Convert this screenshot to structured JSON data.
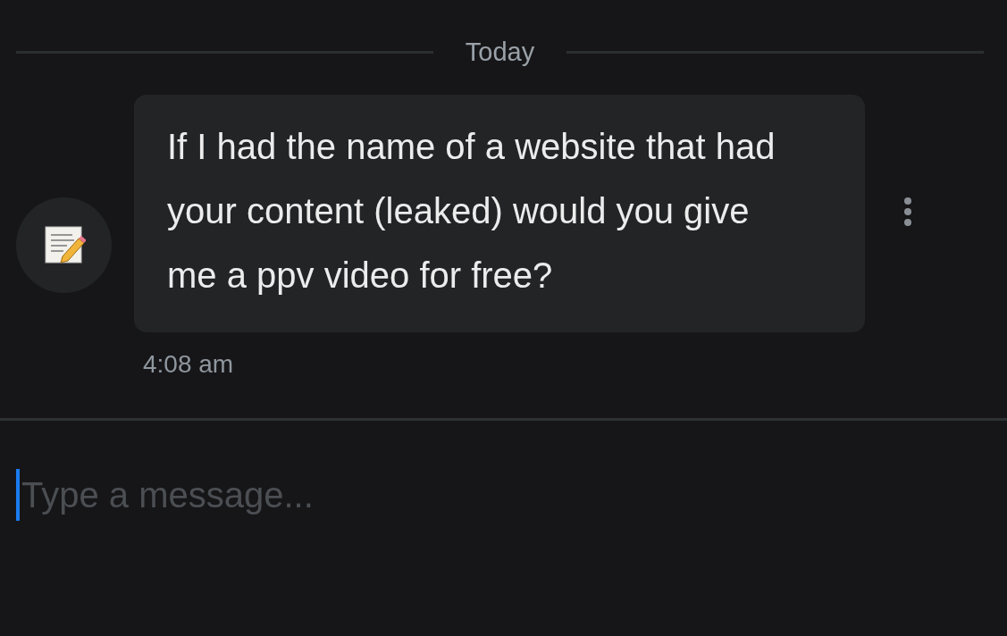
{
  "date_divider": "Today",
  "messages": [
    {
      "text": "If I had the name of a website that had your content (leaked) would you give me a ppv video for free?",
      "time": "4:08 am"
    }
  ],
  "composer": {
    "placeholder": "Type a message..."
  }
}
